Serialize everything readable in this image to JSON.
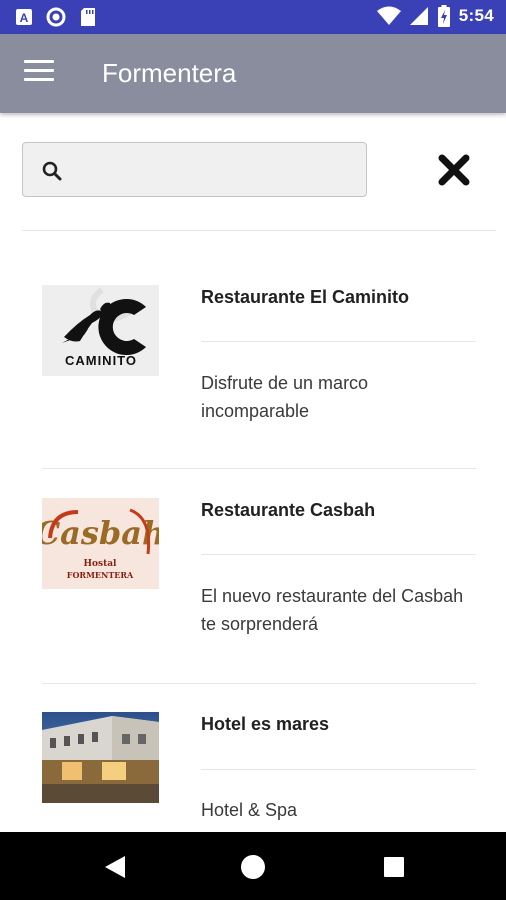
{
  "status_bar": {
    "time": "5:54",
    "icons": [
      "app-a-icon",
      "circle-app-icon",
      "sd-card-icon",
      "wifi-icon",
      "signal-icon",
      "battery-charging-icon"
    ]
  },
  "app_bar": {
    "title": "Formentera",
    "menu_icon": "hamburger-menu-icon"
  },
  "search": {
    "value": "",
    "placeholder": "",
    "icon": "search-icon",
    "clear_icon": "close-icon"
  },
  "items": [
    {
      "title": "Restaurante El Caminito",
      "description": "Disfrute de un marco incomparable",
      "logo_text": "CAMINITO"
    },
    {
      "title": "Restaurante Casbah",
      "description": "El nuevo restaurante del Casbah te sorprenderá",
      "logo_text": "Casbah",
      "logo_sub1": "Hostal",
      "logo_sub2": "FORMENTERA"
    },
    {
      "title": "Hotel es mares",
      "description": "Hotel & Spa"
    }
  ],
  "nav_bar": {
    "icons": [
      "back-icon",
      "home-icon",
      "recents-icon"
    ]
  },
  "colors": {
    "status_bar": "#3a41b6",
    "app_bar": "#8a8d9e",
    "nav_bar": "#000000"
  }
}
